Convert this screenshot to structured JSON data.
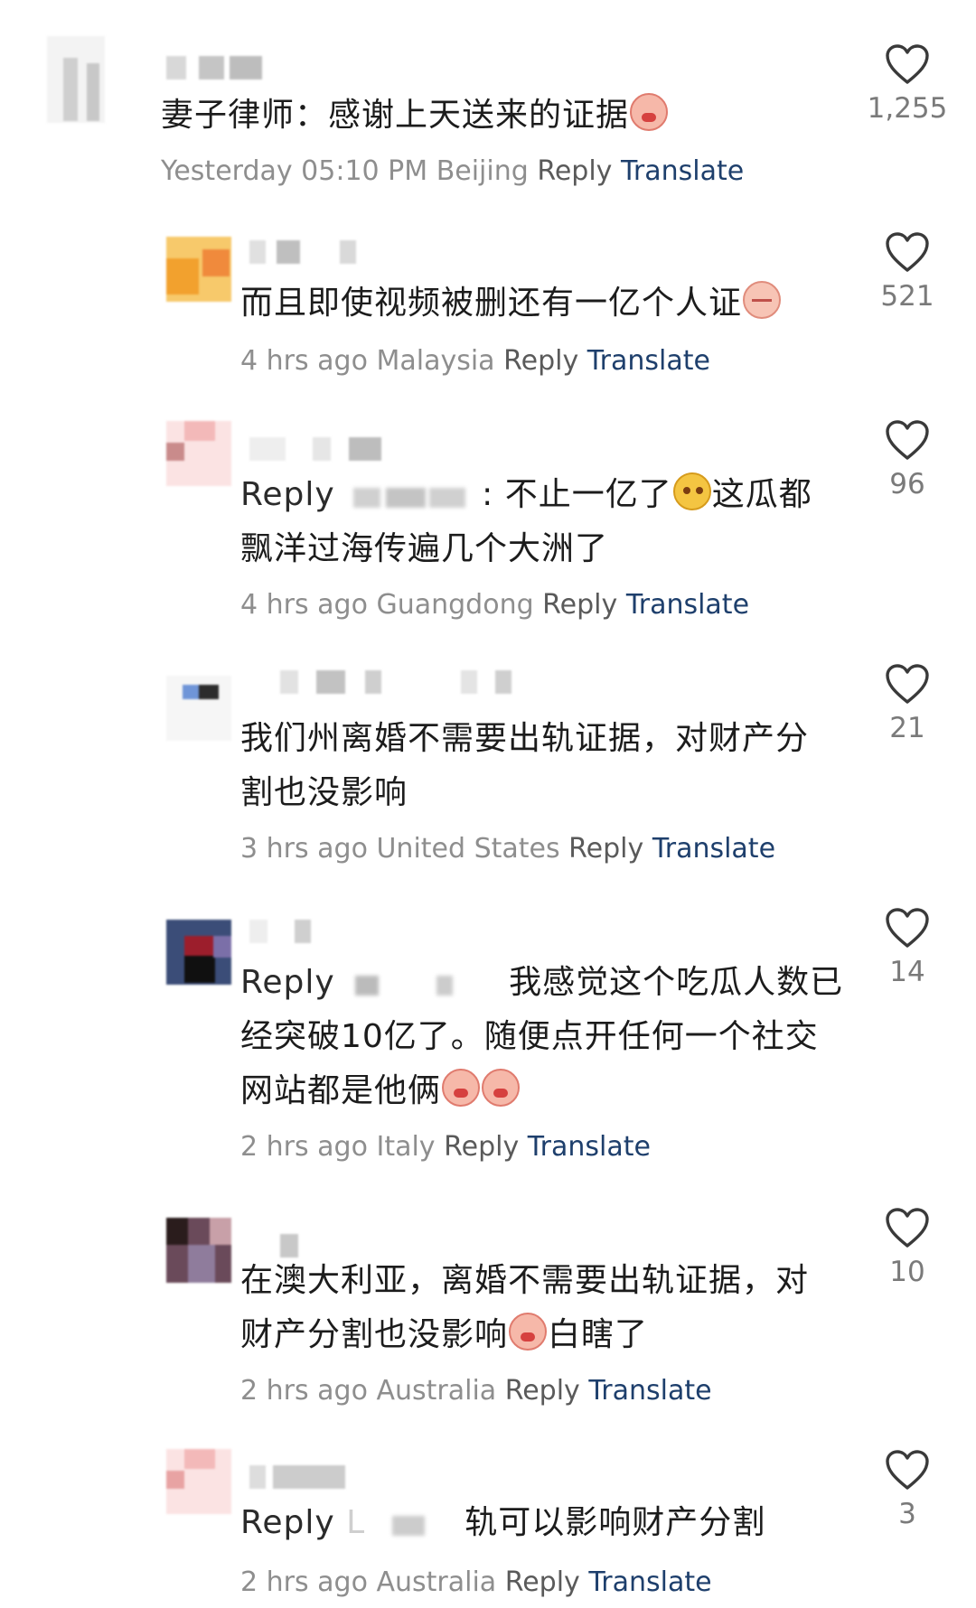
{
  "comments": [
    {
      "text": "妻子律师：感谢上天送来的证据",
      "meta": {
        "time": "Yesterday 05:10 PM",
        "location": "Beijing",
        "reply": "Reply",
        "translate": "Translate"
      },
      "likes": "1,255"
    },
    {
      "text": "而且即使视频被删还有一亿个人证",
      "meta": {
        "time": "4 hrs ago",
        "location": "Malaysia",
        "reply": "Reply",
        "translate": "Translate"
      },
      "likes": "521"
    },
    {
      "reply_prefix": "Reply",
      "text1": ": 不止一亿了",
      "text2": "这瓜都",
      "line2": "飘洋过海传遍几个大洲了",
      "meta": {
        "time": "4 hrs ago",
        "location": "Guangdong",
        "reply": "Reply",
        "translate": "Translate"
      },
      "likes": "96"
    },
    {
      "line1": "我们州离婚不需要出轨证据，对财产分",
      "line2": "割也没影响",
      "meta": {
        "time": "3 hrs ago",
        "location": "United States",
        "reply": "Reply",
        "translate": "Translate"
      },
      "likes": "21"
    },
    {
      "reply_prefix": "Reply",
      "line1": "我感觉这个吃瓜人数已",
      "line2": "经突破10亿了。随便点开任何一个社交",
      "line3": "网站都是他俩",
      "meta": {
        "time": "2 hrs ago",
        "location": "Italy",
        "reply": "Reply",
        "translate": "Translate"
      },
      "likes": "14"
    },
    {
      "line1": "在澳大利亚，离婚不需要出轨证据，对",
      "line2": "财产分割也没影响",
      "line2b": "白瞎了",
      "meta": {
        "time": "2 hrs ago",
        "location": "Australia",
        "reply": "Reply",
        "translate": "Translate"
      },
      "likes": "10"
    },
    {
      "reply_prefix": "Reply",
      "reply_partial": "L",
      "line1": "轨可以影响财产分割",
      "meta": {
        "time": "2 hrs ago",
        "location": "Australia",
        "reply": "Reply",
        "translate": "Translate"
      },
      "likes": "3"
    }
  ],
  "icons": {
    "like": "heart-outline-icon"
  },
  "colors": {
    "translate": "#1e3f6c",
    "meta": "#8e8e8e",
    "text": "#1c1c1c"
  }
}
